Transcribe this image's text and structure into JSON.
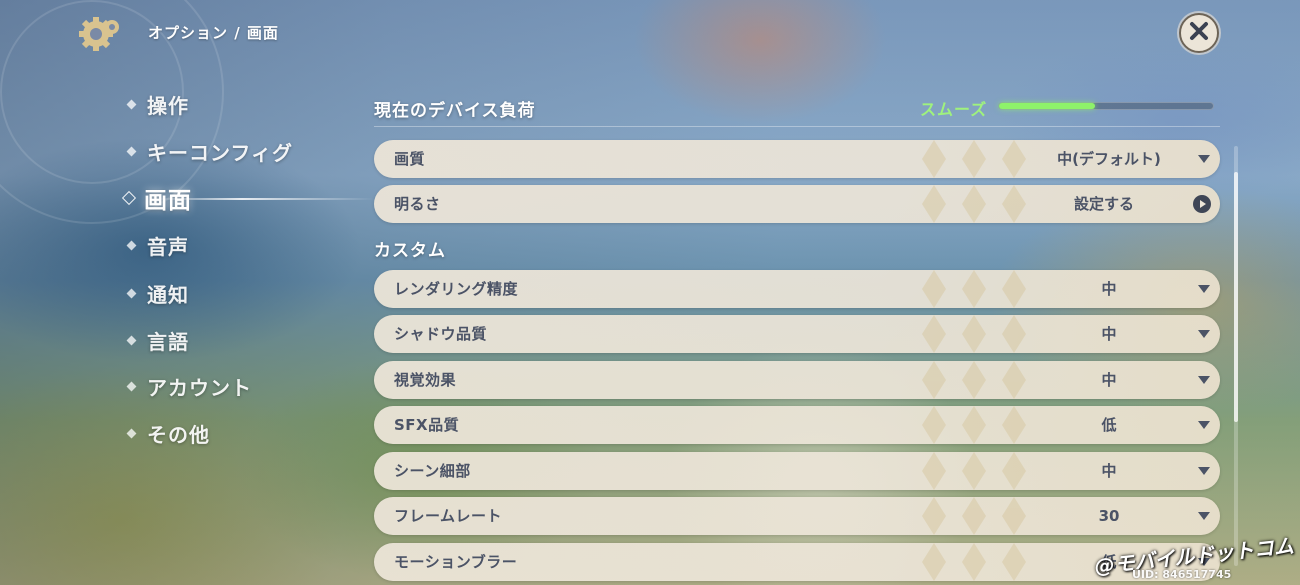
{
  "header": {
    "breadcrumb": "オプション / 画面"
  },
  "sidebar": {
    "items": [
      {
        "label": "操作"
      },
      {
        "label": "キーコンフィグ"
      },
      {
        "label": "画面",
        "active": true
      },
      {
        "label": "音声"
      },
      {
        "label": "通知"
      },
      {
        "label": "言語"
      },
      {
        "label": "アカウント"
      },
      {
        "label": "その他"
      }
    ]
  },
  "device_load": {
    "title": "現在のデバイス負荷",
    "status": "スムーズ",
    "level_fraction": 0.45,
    "status_color": "#9ff27d"
  },
  "settings": {
    "quality": {
      "label": "画質",
      "value": "中(デフォルト)"
    },
    "brightness": {
      "label": "明るさ",
      "value": "設定する"
    }
  },
  "custom": {
    "title": "カスタム",
    "rows": [
      {
        "label": "レンダリング精度",
        "value": "中"
      },
      {
        "label": "シャドウ品質",
        "value": "中"
      },
      {
        "label": "視覚効果",
        "value": "中"
      },
      {
        "label": "SFX品質",
        "value": "低"
      },
      {
        "label": "シーン細部",
        "value": "中"
      },
      {
        "label": "フレームレート",
        "value": "30"
      },
      {
        "label": "モーションブラー",
        "value": "低"
      }
    ]
  },
  "watermark": "@モバイルドットコム",
  "uid": "UID: 846517745",
  "icons": {
    "gear": "gear-icon",
    "close": "close-icon",
    "dropdown": "caret-down-icon",
    "arrow": "arrow-right-circle-icon"
  },
  "colors": {
    "panel": "#ece5d8",
    "text_dark": "#4b5366",
    "accent_green": "#8ef26a"
  }
}
